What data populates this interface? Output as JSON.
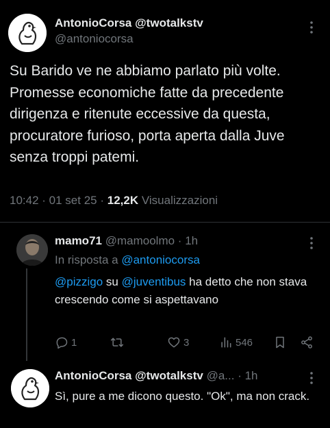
{
  "main_post": {
    "display_name": "AntonioCorsa @twotalkstv",
    "handle": "@antoniocorsa",
    "text": "Su Barido ve ne abbiamo parlato più volte. Promesse economiche fatte da precedente dirigenza e ritenute eccessive da questa, procuratore furioso, porta aperta dalla Juve senza troppi patemi.",
    "time": "10:42",
    "date": "01 set 25",
    "views_count": "12,2K",
    "views_label": "Visualizzazioni"
  },
  "reply1": {
    "display_name": "mamo71",
    "handle": "@mamoolmo",
    "age": "1h",
    "replying_prefix": "In risposta a",
    "replying_to": "@antoniocorsa",
    "mention1": "@pizzigo",
    "word_su": "su",
    "mention2": "@juventibus",
    "text_rest": "ha detto che non stava crescendo come si aspettavano",
    "replies": "1",
    "retweets": "",
    "likes": "3",
    "views": "546"
  },
  "reply2": {
    "display_name": "AntonioCorsa @twotalkstv",
    "handle": "@a...",
    "age": "1h",
    "text": "Sì, pure a me dicono questo. \"Ok\", ma non crack."
  },
  "icons": [
    "duck-avatar-icon",
    "more-icon",
    "reply-icon",
    "retweet-icon",
    "like-icon",
    "views-icon",
    "bookmark-icon",
    "share-icon"
  ]
}
